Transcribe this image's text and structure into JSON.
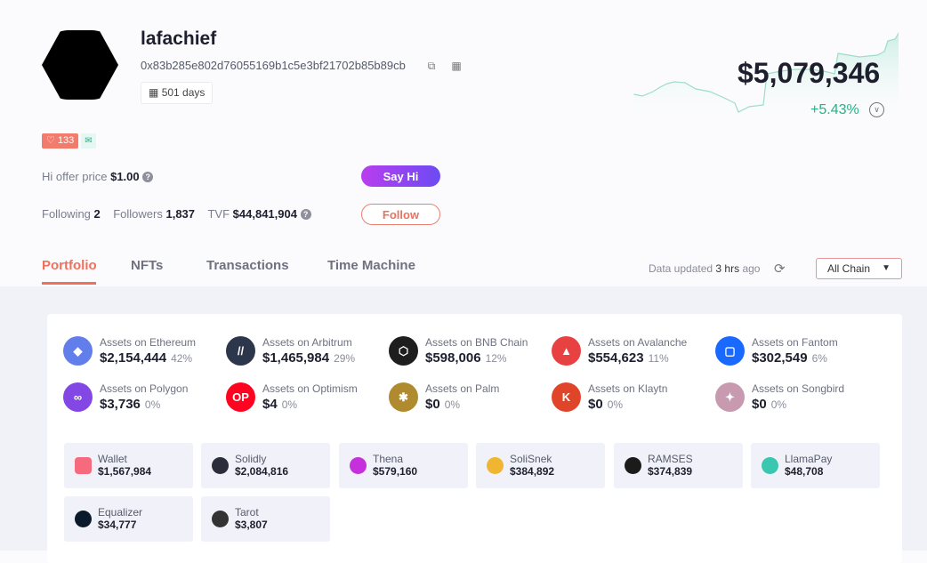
{
  "profile": {
    "name": "lafachief",
    "address": "0x83b285e802d76055169b1c5e3bf21702b85b89cb",
    "days": "501 days",
    "badge_count": "133",
    "hi_offer_label": "Hi offer price",
    "hi_offer_value": "$1.00",
    "following_label": "Following",
    "following": "2",
    "followers_label": "Followers",
    "followers": "1,837",
    "tvf_label": "TVF",
    "tvf": "$44,841,904",
    "say_hi": "Say Hi",
    "follow": "Follow"
  },
  "net_worth": {
    "total": "$5,079,346",
    "change": "+5.43%",
    "accent": "#24b387"
  },
  "tabs": [
    {
      "label": "Portfolio",
      "active": true
    },
    {
      "label": "NFTs"
    },
    {
      "label": "Transactions"
    },
    {
      "label": "Time Machine"
    }
  ],
  "update": {
    "prefix": "Data updated",
    "time": "3 hrs",
    "suffix": "ago",
    "chain_select": "All Chain"
  },
  "chains": [
    {
      "label": "Assets on Ethereum",
      "value": "$2,154,444",
      "pct": "42%",
      "color": "#627eea",
      "icon": "ethereum-icon",
      "glyph": "◆"
    },
    {
      "label": "Assets on Arbitrum",
      "value": "$1,465,984",
      "pct": "29%",
      "color": "#2d374b",
      "icon": "arbitrum-icon",
      "glyph": "//"
    },
    {
      "label": "Assets on BNB Chain",
      "value": "$598,006",
      "pct": "12%",
      "color": "#1e1e1e",
      "icon": "bnb-icon",
      "glyph": "⬡"
    },
    {
      "label": "Assets on Avalanche",
      "value": "$554,623",
      "pct": "11%",
      "color": "#e84142",
      "icon": "avalanche-icon",
      "glyph": "▲"
    },
    {
      "label": "Assets on Fantom",
      "value": "$302,549",
      "pct": "6%",
      "color": "#1969ff",
      "icon": "fantom-icon",
      "glyph": "▢"
    },
    {
      "label": "Assets on Polygon",
      "value": "$3,736",
      "pct": "0%",
      "color": "#8247e5",
      "icon": "polygon-icon",
      "glyph": "∞"
    },
    {
      "label": "Assets on Optimism",
      "value": "$4",
      "pct": "0%",
      "color": "#ff0420",
      "icon": "optimism-icon",
      "glyph": "OP"
    },
    {
      "label": "Assets on Palm",
      "value": "$0",
      "pct": "0%",
      "color": "#b08a2e",
      "icon": "palm-icon",
      "glyph": "✱"
    },
    {
      "label": "Assets on Klaytn",
      "value": "$0",
      "pct": "0%",
      "color": "#e0452a",
      "icon": "klaytn-icon",
      "glyph": "K"
    },
    {
      "label": "Assets on Songbird",
      "value": "$0",
      "pct": "0%",
      "color": "#c79ab0",
      "icon": "songbird-icon",
      "glyph": "✦"
    }
  ],
  "protocols": [
    {
      "label": "Wallet",
      "value": "$1,567,984",
      "color": "#f56b7d",
      "icon": "wallet-icon"
    },
    {
      "label": "Solidly",
      "value": "$2,084,816",
      "color": "#2b2d3a",
      "icon": "solidly-icon"
    },
    {
      "label": "Thena",
      "value": "$579,160",
      "color": "#c52fdc",
      "icon": "thena-icon"
    },
    {
      "label": "SoliSnek",
      "value": "$384,892",
      "color": "#f0b531",
      "icon": "solisnek-icon"
    },
    {
      "label": "RAMSES",
      "value": "$374,839",
      "color": "#1b1b1b",
      "icon": "ramses-icon"
    },
    {
      "label": "LlamaPay",
      "value": "$48,708",
      "color": "#3ac7b0",
      "icon": "llamapay-icon"
    },
    {
      "label": "Equalizer",
      "value": "$34,777",
      "color": "#0a1a2a",
      "icon": "equalizer-icon"
    },
    {
      "label": "Tarot",
      "value": "$3,807",
      "color": "#333333",
      "icon": "tarot-icon"
    }
  ]
}
